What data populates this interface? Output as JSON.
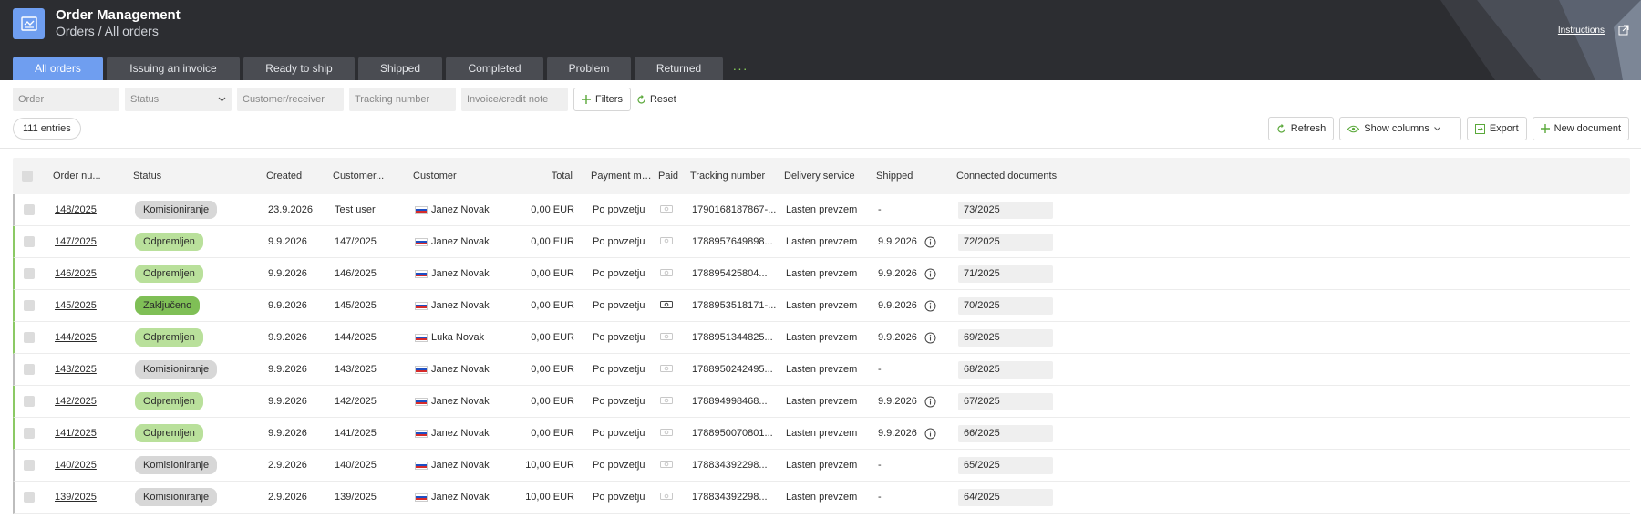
{
  "header": {
    "title": "Order Management",
    "breadcrumb": "Orders / All orders",
    "instructions_label": "Instructions",
    "bg_color": "#2c2d31",
    "accent_color": "#6f9ef0"
  },
  "tabs": [
    {
      "label": "All orders",
      "active": true
    },
    {
      "label": "Issuing an invoice"
    },
    {
      "label": "Ready to ship"
    },
    {
      "label": "Shipped"
    },
    {
      "label": "Completed"
    },
    {
      "label": "Problem"
    },
    {
      "label": "Returned"
    }
  ],
  "tab_more": "···",
  "filters": {
    "order_placeholder": "Order",
    "status_placeholder": "Status",
    "customer_placeholder": "Customer/receiver",
    "tracking_placeholder": "Tracking number",
    "invoice_placeholder": "Invoice/credit note",
    "filters_label": "Filters",
    "reset_label": "Reset"
  },
  "entries_label": "111 entries",
  "actions": {
    "refresh": "Refresh",
    "show_columns": "Show columns",
    "export": "Export",
    "new_document": "New document"
  },
  "columns": [
    "Order nu...",
    "Status",
    "Created",
    "Customer...",
    "Customer",
    "Total",
    "Payment me...",
    "Paid",
    "Tracking number",
    "Delivery service",
    "Shipped",
    "Connected documents"
  ],
  "rows": [
    {
      "order": "148/2025",
      "status": "Komisioniranje",
      "status_color": "grey",
      "created": "23.9.2026",
      "cust_ref": "Test user",
      "customer": "Janez Novak",
      "total": "0,00 EUR",
      "payment": "Po povzetju",
      "paid": false,
      "tracking": "1790168187867-...",
      "delivery": "Lasten prevzem",
      "shipped": "-",
      "doc": "73/2025"
    },
    {
      "order": "147/2025",
      "status": "Odpremljen",
      "status_color": "green",
      "created": "9.9.2026",
      "cust_ref": "147/2025",
      "customer": "Janez Novak",
      "total": "0,00 EUR",
      "payment": "Po povzetju",
      "paid": false,
      "tracking": "1788957649898...",
      "delivery": "Lasten prevzem",
      "shipped": "9.9.2026",
      "doc": "72/2025"
    },
    {
      "order": "146/2025",
      "status": "Odpremljen",
      "status_color": "green",
      "created": "9.9.2026",
      "cust_ref": "146/2025",
      "customer": "Janez Novak",
      "total": "0,00 EUR",
      "payment": "Po povzetju",
      "paid": false,
      "tracking": "178895425804...",
      "delivery": "Lasten prevzem",
      "shipped": "9.9.2026",
      "doc": "71/2025"
    },
    {
      "order": "145/2025",
      "status": "Zaključeno",
      "status_color": "dgreen",
      "created": "9.9.2026",
      "cust_ref": "145/2025",
      "customer": "Janez Novak",
      "total": "0,00 EUR",
      "payment": "Po povzetju",
      "paid": true,
      "tracking": "178895351817​1-...",
      "delivery": "Lasten prevzem",
      "shipped": "9.9.2026",
      "doc": "70/2025"
    },
    {
      "order": "144/2025",
      "status": "Odpremljen",
      "status_color": "green",
      "created": "9.9.2026",
      "cust_ref": "144/2025",
      "customer": "Luka Novak",
      "total": "0,00 EUR",
      "payment": "Po povzetju",
      "paid": false,
      "tracking": "178895134482​5...",
      "delivery": "Lasten prevzem",
      "shipped": "9.9.2026",
      "doc": "69/2025"
    },
    {
      "order": "143/2025",
      "status": "Komisioniranje",
      "status_color": "grey",
      "created": "9.9.2026",
      "cust_ref": "143/2025",
      "customer": "Janez Novak",
      "total": "0,00 EUR",
      "payment": "Po povzetju",
      "paid": false,
      "tracking": "178895024249​5...",
      "delivery": "Lasten prevzem",
      "shipped": "-",
      "doc": "68/2025"
    },
    {
      "order": "142/2025",
      "status": "Odpremljen",
      "status_color": "green",
      "created": "9.9.2026",
      "cust_ref": "142/2025",
      "customer": "Janez Novak",
      "total": "0,00 EUR",
      "payment": "Po povzetju",
      "paid": false,
      "tracking": "178894998468...",
      "delivery": "Lasten prevzem",
      "shipped": "9.9.2026",
      "doc": "67/2025"
    },
    {
      "order": "141/2025",
      "status": "Odpremljen",
      "status_color": "green",
      "created": "9.9.2026",
      "cust_ref": "141/2025",
      "customer": "Janez Novak",
      "total": "0,00 EUR",
      "payment": "Po povzetju",
      "paid": false,
      "tracking": "178895007080​1...",
      "delivery": "Lasten prevzem",
      "shipped": "9.9.2026",
      "doc": "66/2025"
    },
    {
      "order": "140/2025",
      "status": "Komisioniranje",
      "status_color": "grey",
      "created": "2.9.2026",
      "cust_ref": "140/2025",
      "customer": "Janez Novak",
      "total": "10,00 EUR",
      "payment": "Po povzetju",
      "paid": false,
      "tracking": "178834392298...",
      "delivery": "Lasten prevzem",
      "shipped": "-",
      "doc": "65/2025"
    },
    {
      "order": "139/2025",
      "status": "Komisioniranje",
      "status_color": "grey",
      "created": "2.9.2026",
      "cust_ref": "139/2025",
      "customer": "Janez Novak",
      "total": "10,00 EUR",
      "payment": "Po povzetju",
      "paid": false,
      "tracking": "178834392298...",
      "delivery": "Lasten prevzem",
      "shipped": "-",
      "doc": "64/2025"
    }
  ]
}
